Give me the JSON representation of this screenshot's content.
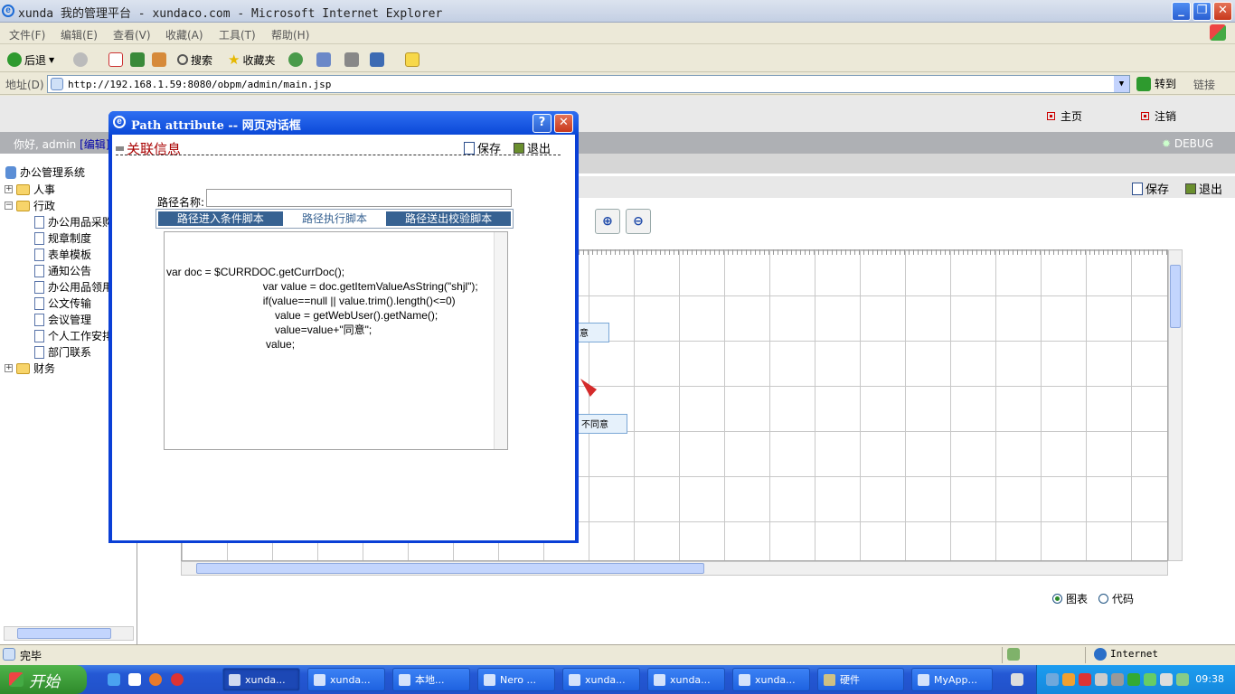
{
  "window": {
    "title": "xunda 我的管理平台 - xundaco.com - Microsoft Internet Explorer"
  },
  "menu": [
    "文件(F)",
    "编辑(E)",
    "查看(V)",
    "收藏(A)",
    "工具(T)",
    "帮助(H)"
  ],
  "toolbar": {
    "back": "后退",
    "search": "搜索",
    "favorites": "收藏夹"
  },
  "address": {
    "label": "地址(D)",
    "url": "http://192.168.1.59:8080/obpm/admin/main.jsp",
    "go": "转到",
    "links": "链接"
  },
  "app": {
    "home": "主页",
    "logout": "注销",
    "greeting": "你好, admin",
    "edit": "[编辑]",
    "debug": "DEBUG",
    "save": "保存",
    "exit": "退出"
  },
  "tree": {
    "root": "办公管理系统",
    "nodes": [
      {
        "label": "人事",
        "type": "folder",
        "sign": "+"
      },
      {
        "label": "行政",
        "type": "folder",
        "sign": "−"
      },
      {
        "label": "办公用品采购",
        "type": "doc"
      },
      {
        "label": "规章制度",
        "type": "doc"
      },
      {
        "label": "表单模板",
        "type": "doc"
      },
      {
        "label": "通知公告",
        "type": "doc"
      },
      {
        "label": "办公用品领用",
        "type": "doc"
      },
      {
        "label": "公文传输",
        "type": "doc"
      },
      {
        "label": "会议管理",
        "type": "doc"
      },
      {
        "label": "个人工作安排",
        "type": "doc"
      },
      {
        "label": "部门联系",
        "type": "doc"
      },
      {
        "label": "财务",
        "type": "folder",
        "sign": "+"
      }
    ]
  },
  "canvas": {
    "node1": "意",
    "node2": "不同意"
  },
  "view_mode": {
    "chart": "图表",
    "code": "代码",
    "selected": "chart"
  },
  "dialog": {
    "title": "Path attribute -- 网页对话框",
    "heading": "关联信息",
    "save": "保存",
    "exit": "退出",
    "path_name_label": "路径名称:",
    "path_name_value": "",
    "tabs": [
      "路径进入条件脚本",
      "路径执行脚本",
      "路径送出校验脚本"
    ],
    "active_tab": 1,
    "code": "var doc = $CURRDOC.getCurrDoc();\n                                var value = doc.getItemValueAsString(\"shjl\");\n                                if(value==null || value.trim().length()<=0)\n                                    value = getWebUser().getName();\n                                    value=value+\"同意\";\n                                 value;"
  },
  "status": {
    "text": "完毕",
    "zone": "Internet"
  },
  "taskbar": {
    "start": "开始",
    "tasks": [
      "xunda...",
      "xunda...",
      "本地...",
      "Nero ...",
      "xunda...",
      "xunda...",
      "xunda...",
      "硬件",
      "MyApp..."
    ],
    "clock": "09:38"
  },
  "colors": {
    "dialog_blue": "#0a3fd6",
    "tab_blue": "#376292",
    "heading_red": "#a80000",
    "taskbar": "#2458d4"
  }
}
